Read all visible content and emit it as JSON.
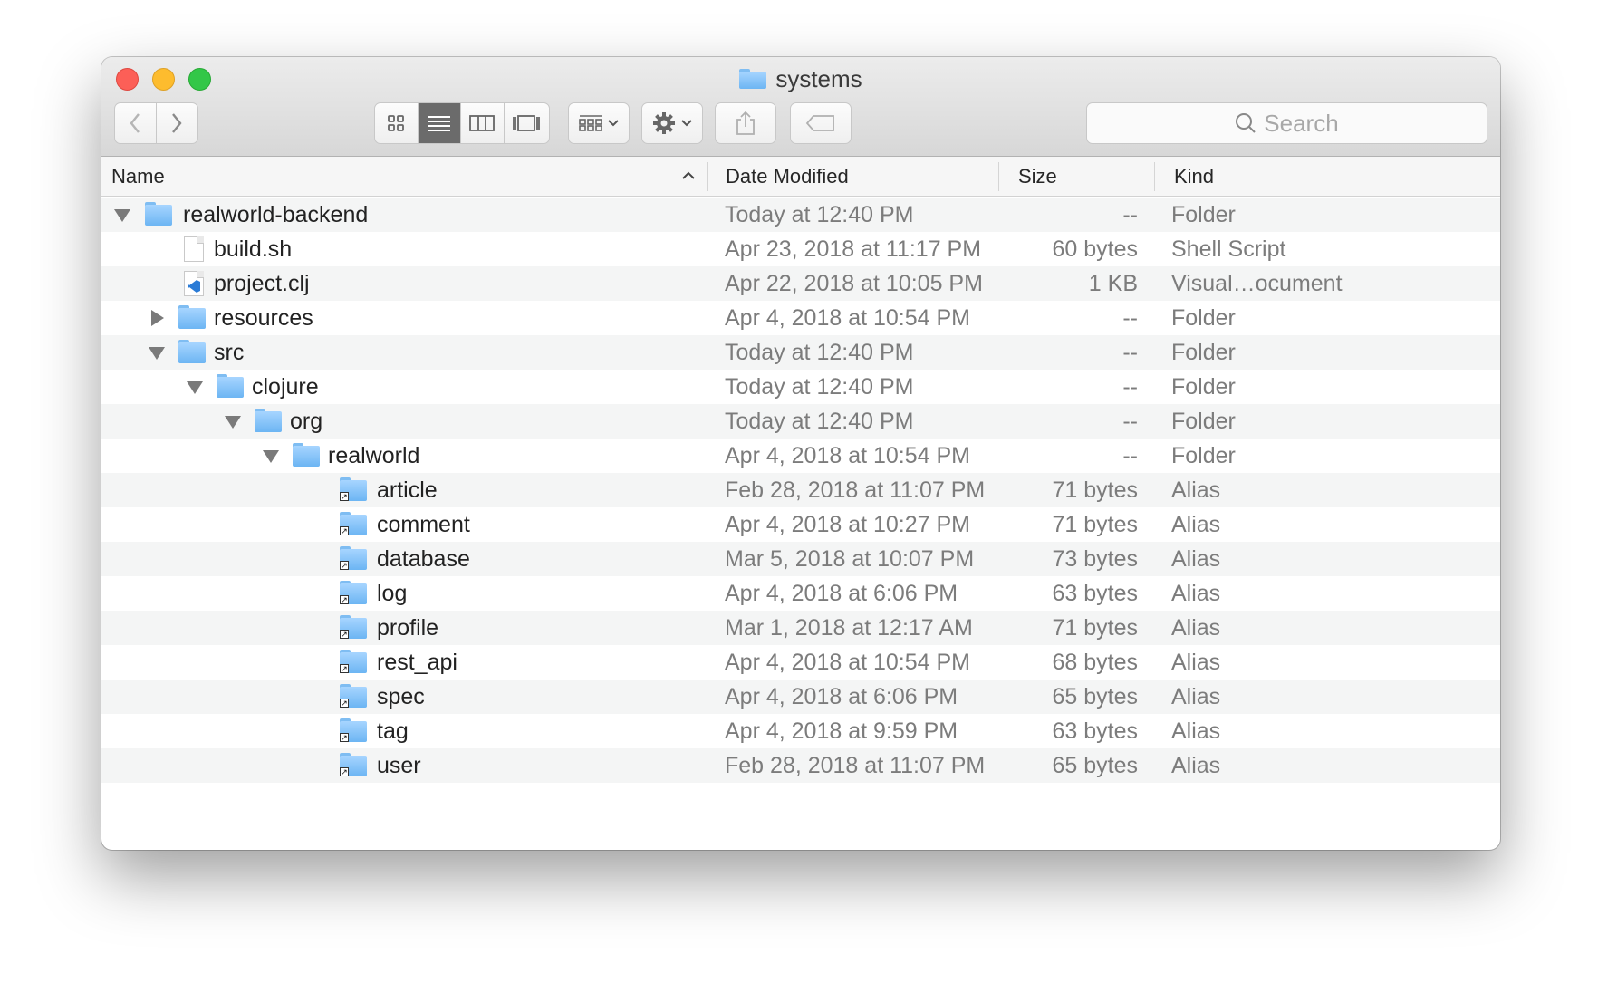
{
  "window": {
    "title": "systems"
  },
  "toolbar": {
    "back_icon": "chevron-left-icon",
    "forward_icon": "chevron-right-icon",
    "view_modes": [
      "icon-view",
      "list-view",
      "column-view",
      "gallery-view"
    ],
    "active_view": "list-view",
    "arrange_icon": "arrange-grid-icon",
    "action_icon": "gear-icon",
    "share_icon": "share-icon",
    "tag_icon": "tag-icon"
  },
  "search": {
    "placeholder": "Search"
  },
  "columns": {
    "name": "Name",
    "date": "Date Modified",
    "size": "Size",
    "kind": "Kind"
  },
  "rows": [
    {
      "name": "realworld-backend",
      "date": "Today at 12:40 PM",
      "size": "--",
      "kind": "Folder",
      "type": "folder",
      "disclosure": "open"
    },
    {
      "name": "build.sh",
      "date": "Apr 23, 2018 at 11:17 PM",
      "size": "60 bytes",
      "kind": "Shell Script",
      "type": "doc"
    },
    {
      "name": "project.clj",
      "date": "Apr 22, 2018 at 10:05 PM",
      "size": "1 KB",
      "kind": "Visual…ocument",
      "type": "vsdoc"
    },
    {
      "name": "resources",
      "date": "Apr 4, 2018 at 10:54 PM",
      "size": "--",
      "kind": "Folder",
      "type": "folder",
      "disclosure": "closed"
    },
    {
      "name": "src",
      "date": "Today at 12:40 PM",
      "size": "--",
      "kind": "Folder",
      "type": "folder",
      "disclosure": "open"
    },
    {
      "name": "clojure",
      "date": "Today at 12:40 PM",
      "size": "--",
      "kind": "Folder",
      "type": "folder",
      "disclosure": "open"
    },
    {
      "name": "org",
      "date": "Today at 12:40 PM",
      "size": "--",
      "kind": "Folder",
      "type": "folder",
      "disclosure": "open"
    },
    {
      "name": "realworld",
      "date": "Apr 4, 2018 at 10:54 PM",
      "size": "--",
      "kind": "Folder",
      "type": "folder",
      "disclosure": "open"
    },
    {
      "name": "article",
      "date": "Feb 28, 2018 at 11:07 PM",
      "size": "71 bytes",
      "kind": "Alias",
      "type": "alias"
    },
    {
      "name": "comment",
      "date": "Apr 4, 2018 at 10:27 PM",
      "size": "71 bytes",
      "kind": "Alias",
      "type": "alias"
    },
    {
      "name": "database",
      "date": "Mar 5, 2018 at 10:07 PM",
      "size": "73 bytes",
      "kind": "Alias",
      "type": "alias"
    },
    {
      "name": "log",
      "date": "Apr 4, 2018 at 6:06 PM",
      "size": "63 bytes",
      "kind": "Alias",
      "type": "alias"
    },
    {
      "name": "profile",
      "date": "Mar 1, 2018 at 12:17 AM",
      "size": "71 bytes",
      "kind": "Alias",
      "type": "alias"
    },
    {
      "name": "rest_api",
      "date": "Apr 4, 2018 at 10:54 PM",
      "size": "68 bytes",
      "kind": "Alias",
      "type": "alias"
    },
    {
      "name": "spec",
      "date": "Apr 4, 2018 at 6:06 PM",
      "size": "65 bytes",
      "kind": "Alias",
      "type": "alias"
    },
    {
      "name": "tag",
      "date": "Apr 4, 2018 at 9:59 PM",
      "size": "63 bytes",
      "kind": "Alias",
      "type": "alias"
    },
    {
      "name": "user",
      "date": "Feb 28, 2018 at 11:07 PM",
      "size": "65 bytes",
      "kind": "Alias",
      "type": "alias"
    }
  ],
  "colors": {
    "folder": "#6cb5f3",
    "close": "#fc5f57",
    "minimize": "#fdbc2e",
    "maximize": "#33c748",
    "active_view": "#6b6b6b"
  }
}
